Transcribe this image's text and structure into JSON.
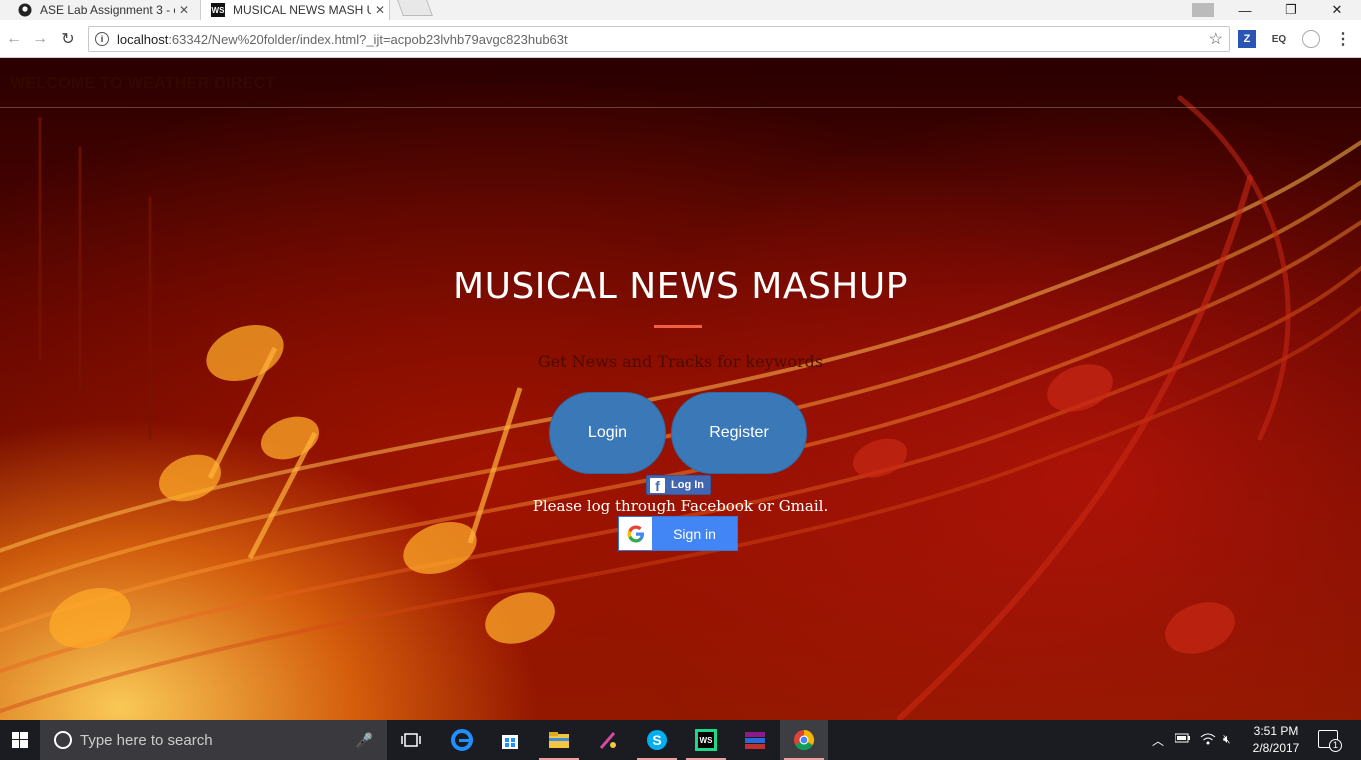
{
  "browser": {
    "tabs": [
      {
        "title": "ASE Lab Assignment 3 - c",
        "icon": "github-icon"
      },
      {
        "title": "MUSICAL NEWS MASH U",
        "icon": "webstorm-icon"
      }
    ],
    "url_host": "localhost",
    "url_rest": ":63342/New%20folder/index.html?_ijt=acpob23lvhb79avgc823hub63t",
    "extensions": [
      "Z",
      "EQ",
      ""
    ]
  },
  "page": {
    "brand": "WELCOME TO WEATHER DIRECT",
    "title": "MUSICAL NEWS MASHUP",
    "subtitle": "Get News and Tracks for keywords",
    "login_label": "Login",
    "register_label": "Register",
    "facebook_label": "Log In",
    "login_note": "Please log through Facebook or Gmail.",
    "google_label": "Sign in"
  },
  "taskbar": {
    "search_placeholder": "Type here to search",
    "time": "3:51 PM",
    "date": "2/8/2017",
    "notifications": "1"
  },
  "colors": {
    "accent_divider": "#f05f40",
    "button_blue": "#3a78b8",
    "facebook_blue": "#4267b2",
    "google_blue": "#4285f4"
  }
}
